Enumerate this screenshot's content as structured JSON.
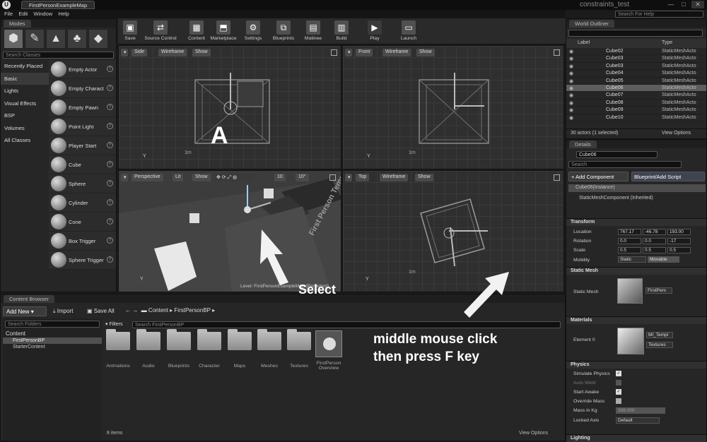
{
  "titlebar": {
    "logo": "U",
    "tab_label": "FirstPersonExampleMap",
    "project_name": "constraints_test",
    "search_placeholder": "Search For Help",
    "min": "—",
    "max": "□",
    "close": "✕"
  },
  "menu": [
    "File",
    "Edit",
    "Window",
    "Help"
  ],
  "modes": {
    "title": "Modes",
    "search_placeholder": "Search Classes",
    "categories": [
      "Recently Placed",
      "Basic",
      "Lights",
      "Visual Effects",
      "BSP",
      "Volumes",
      "All Classes"
    ],
    "items": [
      "Empty Actor",
      "Empty Charact",
      "Empty Pawn",
      "Point Light",
      "Player Start",
      "Cube",
      "Sphere",
      "Cylinder",
      "Cone",
      "Box Trigger",
      "Sphere Trigger"
    ]
  },
  "toolbar": [
    "Save",
    "Source Control",
    "Content",
    "Marketplace",
    "Settings",
    "Blueprints",
    "Matinee",
    "Build",
    "Play",
    "Launch"
  ],
  "viewports": {
    "side": {
      "label": "Side",
      "mode": "Wireframe",
      "show": "Show",
      "scale": "1m",
      "axis": "Y"
    },
    "front": {
      "label": "Front",
      "mode": "Wireframe",
      "show": "Show",
      "scale": "1m",
      "axis": "Y"
    },
    "perspective": {
      "label": "Perspective",
      "mode": "Lit",
      "show": "Show",
      "snap1": "10",
      "snap2": "10°",
      "level_text": "Level:  FirstPersonExampleMap (Persistent)",
      "wall_text": "First Person Template",
      "axis": "Y"
    },
    "top": {
      "label": "Top",
      "mode": "Wireframe",
      "show": "Show",
      "scale": "1m",
      "axis": "Y"
    }
  },
  "overlay": {
    "letter": "A",
    "select": "Select",
    "instruction_line1": "middle mouse click",
    "instruction_line2": "then press F key"
  },
  "outliner": {
    "title": "World Outliner",
    "search_placeholder": "",
    "col_label": "Label",
    "col_type": "Type",
    "rows": [
      {
        "name": "Cube02",
        "type": "StaticMeshActo"
      },
      {
        "name": "Cube03",
        "type": "StaticMeshActo"
      },
      {
        "name": "Cube03",
        "type": "StaticMeshActo"
      },
      {
        "name": "Cube04",
        "type": "StaticMeshActo"
      },
      {
        "name": "Cube05",
        "type": "StaticMeshActo"
      },
      {
        "name": "Cube06",
        "type": "StaticMeshActo"
      },
      {
        "name": "Cube07",
        "type": "StaticMeshActo"
      },
      {
        "name": "Cube08",
        "type": "StaticMeshActo"
      },
      {
        "name": "Cube09",
        "type": "StaticMeshActo"
      },
      {
        "name": "Cube10",
        "type": "StaticMeshActo"
      }
    ],
    "selected_index": 5,
    "status": "30 actors (1 selected)",
    "view_options": "View Options"
  },
  "details": {
    "title": "Details",
    "name_value": "Cube06",
    "search_placeholder": "Search",
    "add_component": "+ Add Component",
    "blueprint_button": "Blueprint/Add Script",
    "instance": "Cube06(Instance)",
    "component": "StaticMeshComponent (Inherited)",
    "transform": {
      "title": "Transform",
      "location_label": "Location",
      "location": [
        "767.17",
        "-46.78",
        "193.00"
      ],
      "rotation_label": "Rotation",
      "rotation": [
        "0.0",
        "0.0",
        "-17"
      ],
      "scale_label": "Scale",
      "scale": [
        "0.5",
        "0.5",
        "0.5"
      ],
      "mobility_label": "Mobility",
      "mobility_static": "Static",
      "mobility_movable": "Movable"
    },
    "static_mesh": {
      "title": "Static Mesh",
      "label": "Static Mesh",
      "value": "FirstPers"
    },
    "materials": {
      "title": "Materials",
      "label": "Element 0",
      "value": "MI_Templ",
      "textures": "Textures"
    },
    "physics": {
      "title": "Physics",
      "simulate": "Simulate Physics",
      "auto_weld": "Auto Weld",
      "start_awake": "Start Awake",
      "override_mass": "Override Mass",
      "mass": "Mass in Kg",
      "mass_value": "308.000",
      "locked_axis": "Locked Axis",
      "locked_value": "Default"
    },
    "lighting": {
      "title": "Lighting"
    }
  },
  "content_browser": {
    "title": "Content Browser",
    "add_new": "Add New",
    "import": "Import",
    "save_all": "Save All",
    "path": [
      "Content",
      "FirstPersonBP"
    ],
    "folder_search": "Search Folders",
    "tree_root": "Content",
    "tree_children": [
      "FirstPersonBP",
      "StarterContent"
    ],
    "filters": "Filters",
    "asset_search": "Search FirstPersonBP",
    "folders": [
      "Animations",
      "Audio",
      "Blueprints",
      "Character",
      "Maps",
      "Meshes",
      "Textures"
    ],
    "asset_name_line1": "FirstPerson",
    "asset_name_line2": "Overview",
    "count": "8 items",
    "view_options": "View Options"
  }
}
